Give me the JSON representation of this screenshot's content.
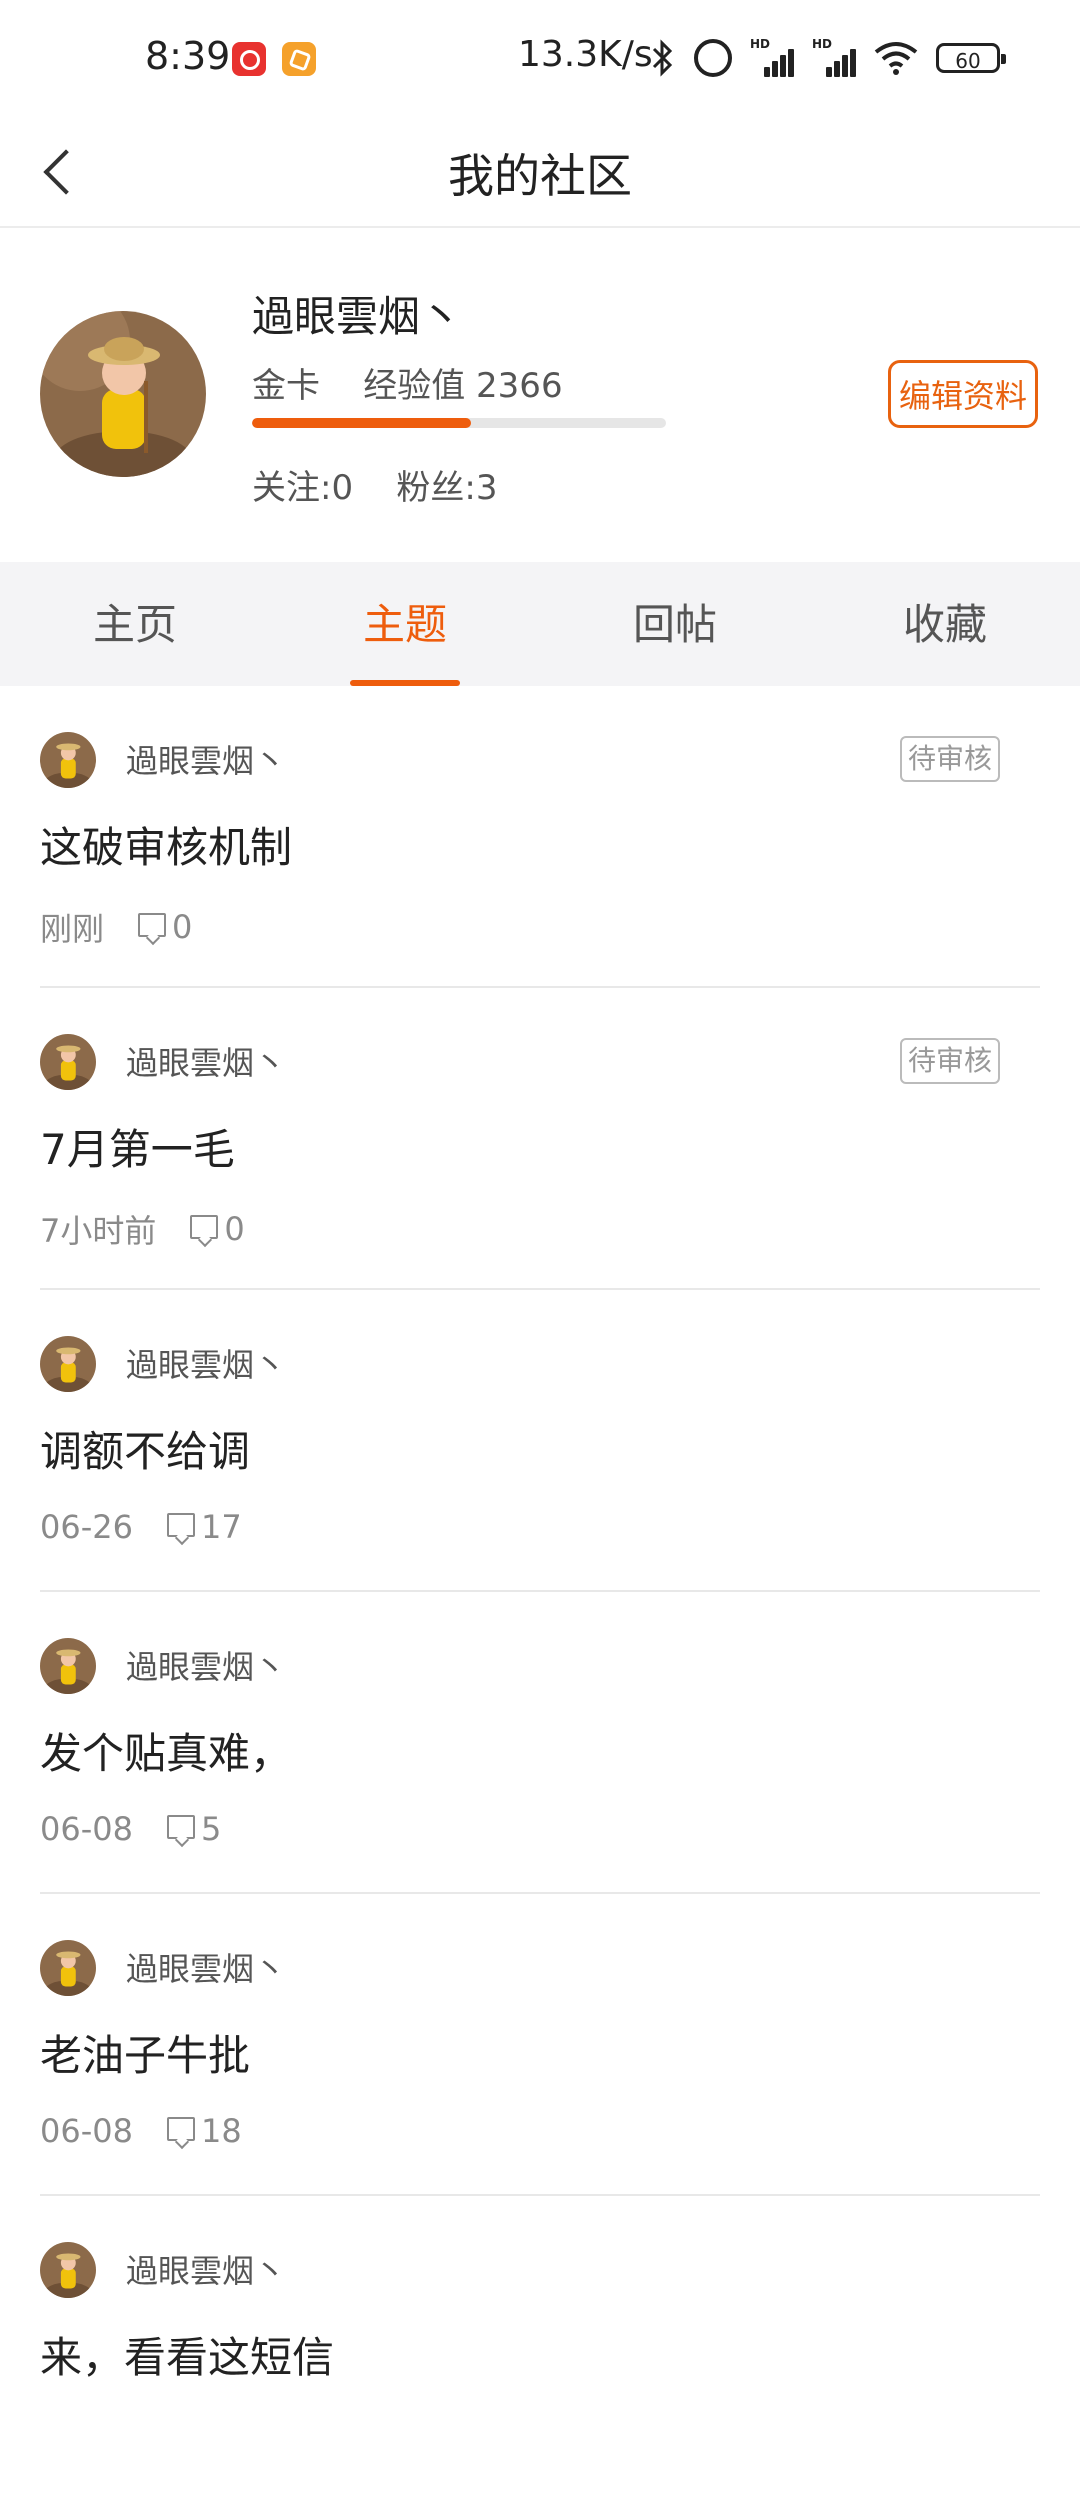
{
  "status_bar": {
    "time": "8:39",
    "network_speed": "13.3K/s",
    "battery": "60",
    "signal_label": "HD"
  },
  "header": {
    "title": "我的社区"
  },
  "profile": {
    "username": "過眼雲烟丶",
    "card_level": "金卡",
    "exp_label": "经验值",
    "exp_value": "2366",
    "level_progress": 0.53,
    "following_label": "关注:",
    "following_count": "0",
    "followers_label": "粉丝:",
    "followers_count": "3",
    "edit_label": "编辑资料"
  },
  "tabs": [
    {
      "label": "主页",
      "active": false
    },
    {
      "label": "主题",
      "active": true
    },
    {
      "label": "回帖",
      "active": false
    },
    {
      "label": "收藏",
      "active": false
    }
  ],
  "posts": [
    {
      "author": "過眼雲烟丶",
      "badge": "待审核",
      "title": "这破审核机制",
      "time": "刚刚",
      "comments": "0"
    },
    {
      "author": "過眼雲烟丶",
      "badge": "待审核",
      "title": "7月第一毛",
      "time": "7小时前",
      "comments": "0"
    },
    {
      "author": "過眼雲烟丶",
      "badge": "",
      "title": "调额不给调",
      "time": "06-26",
      "comments": "17"
    },
    {
      "author": "過眼雲烟丶",
      "badge": "",
      "title": "发个贴真难，",
      "time": "06-08",
      "comments": "5"
    },
    {
      "author": "過眼雲烟丶",
      "badge": "",
      "title": "老油子牛批",
      "time": "06-08",
      "comments": "18"
    },
    {
      "author": "過眼雲烟丶",
      "badge": "",
      "title": "来，看看这短信",
      "time": "",
      "comments": ""
    }
  ],
  "colors": {
    "accent": "#ee5d0d",
    "tab_bg": "#f4f4f6",
    "divider": "#e8e8e8"
  },
  "icons": [
    "back-arrow-icon",
    "bluetooth-icon",
    "alarm-icon",
    "signal-icon",
    "wifi-icon",
    "battery-icon",
    "comment-icon"
  ]
}
